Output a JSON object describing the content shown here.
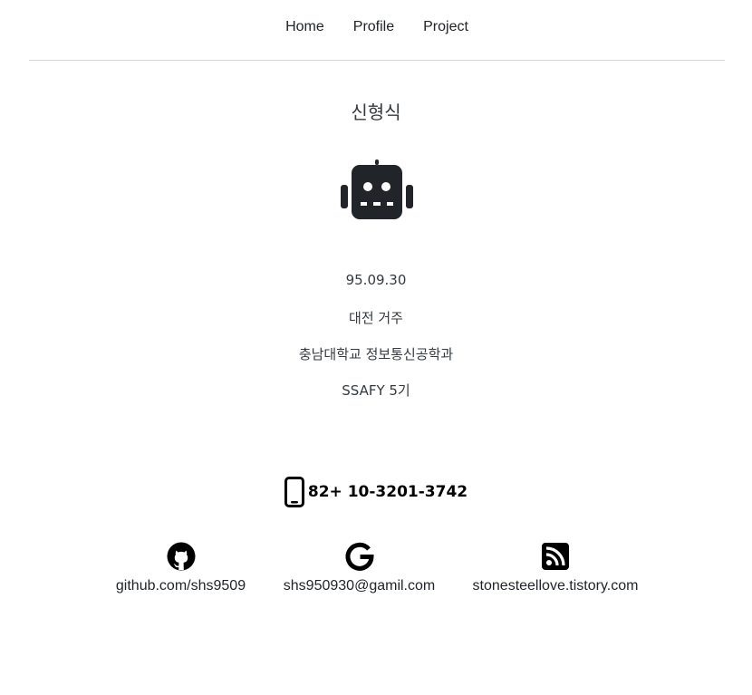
{
  "nav": {
    "items": [
      {
        "label": "Home"
      },
      {
        "label": "Profile"
      },
      {
        "label": "Project"
      }
    ]
  },
  "profile": {
    "name": "신형식",
    "avatar_icon": "robot-icon",
    "birth": "95.09.30",
    "location": "대전 거주",
    "school": "충남대학교 정보통신공학과",
    "ssafy": "SSAFY 5기"
  },
  "contact": {
    "phone_icon": "mobile-phone-icon",
    "phone": "82+ 10-3201-3742",
    "links": [
      {
        "icon": "github-icon",
        "label": "github.com/shs9509"
      },
      {
        "icon": "google-icon",
        "label": "shs950930@gamil.com"
      },
      {
        "icon": "rss-icon",
        "label": "stonesteellove.tistory.com"
      }
    ]
  },
  "colors": {
    "text": "#212529",
    "icon": "#212529",
    "divider": "#d4d4d4"
  }
}
